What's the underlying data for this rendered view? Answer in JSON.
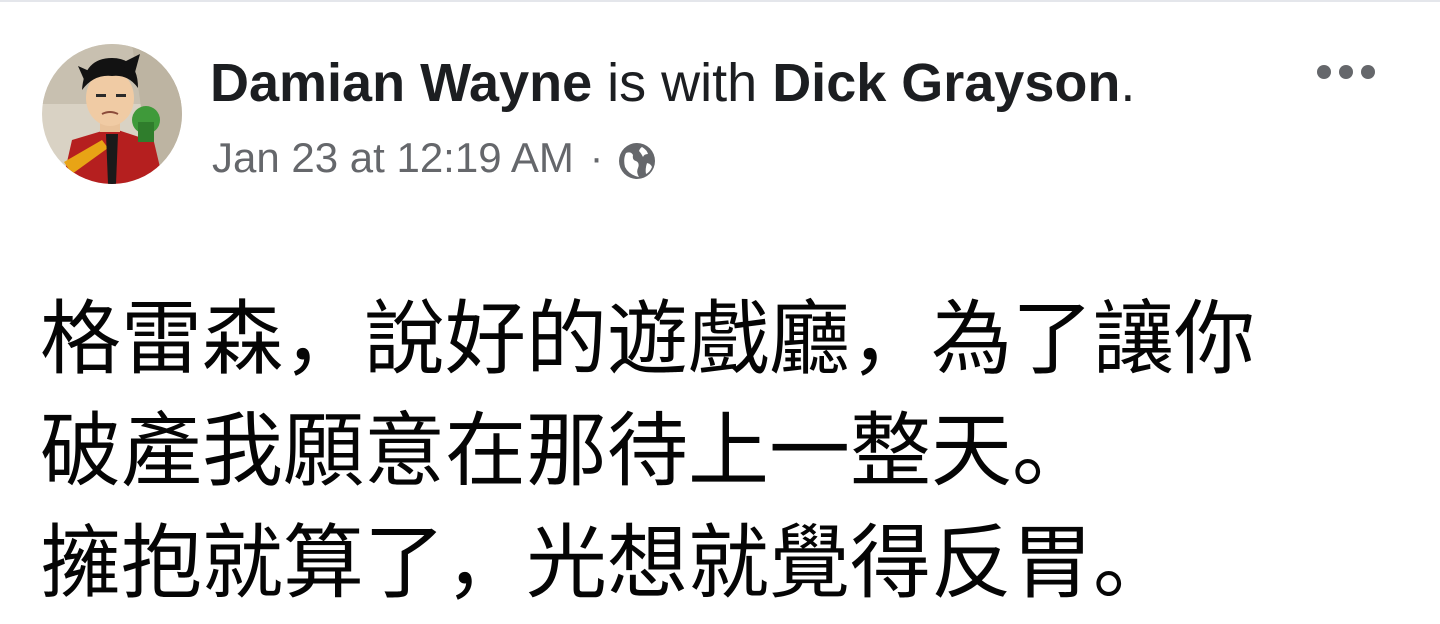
{
  "post": {
    "author_name": "Damian Wayne",
    "connector": "is with",
    "tagged_name": "Dick Grayson",
    "trailing_punct": ".",
    "timestamp": "Jan 23 at 12:19 AM",
    "separator": "·",
    "audience_icon": "globe-icon",
    "more_icon": "more-horizontal-icon",
    "text_lines": [
      "格雷森，說好的遊戲廳，為了讓你",
      "破產我願意在那待上一整天。",
      "擁抱就算了，光想就覺得反胃。"
    ]
  },
  "colors": {
    "primary_text": "#1c1e21",
    "secondary_text": "#65676b",
    "background": "#ffffff"
  }
}
